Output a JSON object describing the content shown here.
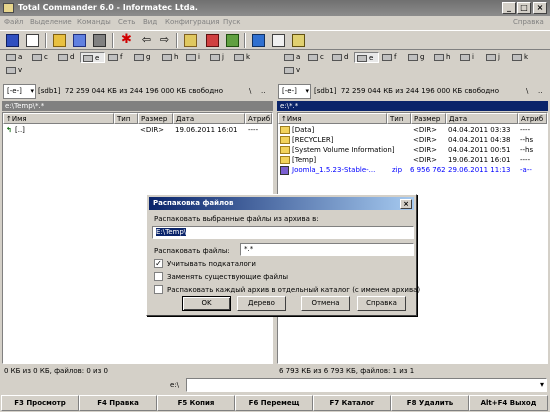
{
  "window": {
    "title": "Total Commander 6.0 - Informatec Ltda."
  },
  "menu": {
    "items": [
      "Файл",
      "Выделение",
      "Команды",
      "Сеть",
      "Вид",
      "Конфигурация",
      "Пуск"
    ],
    "help": "Справка"
  },
  "drives": [
    "a",
    "c",
    "d",
    "e",
    "f",
    "g",
    "h",
    "i",
    "j",
    "k",
    "v"
  ],
  "left": {
    "drive_select": "[-e-]",
    "volume": "[sdb1]",
    "free_info": "72 259 044 КБ из 244 196 000 КБ свободно",
    "root_btn": "\\",
    "up_btn": "..",
    "path": "e:\\Temp\\*.*",
    "active_drive": "e"
  },
  "right": {
    "drive_select": "[-e-]",
    "volume": "[sdb1]",
    "free_info": "72 259 044 КБ из 244 196 000 КБ свободно",
    "root_btn": "\\",
    "up_btn": "..",
    "path": "e:\\*.*",
    "active_drive": "e"
  },
  "columns": {
    "name": "↑Имя",
    "type": "Тип",
    "size": "Размер",
    "date": "Дата",
    "attr": "Атриб"
  },
  "left_files": [
    {
      "name": "[..]",
      "size": "<DIR>",
      "date": "19.06.2011 16:01",
      "attr": "----"
    }
  ],
  "right_files": [
    {
      "name": "[Data]",
      "size": "<DIR>",
      "date": "04.04.2011 03:33",
      "attr": "----"
    },
    {
      "name": "[RECYCLER]",
      "size": "<DIR>",
      "date": "04.04.2011 04:38",
      "attr": "--hs"
    },
    {
      "name": "[System Volume Information]",
      "size": "<DIR>",
      "date": "04.04.2011 00:51",
      "attr": "--hs"
    },
    {
      "name": "[Temp]",
      "size": "<DIR>",
      "date": "19.06.2011 16:01",
      "attr": "----"
    },
    {
      "name": "Joomla_1.5.23-Stable-...",
      "type": "zip",
      "size": "6 956 762",
      "date": "29.06.2011 11:13",
      "attr": "-a--"
    }
  ],
  "status": {
    "left": "0 КБ из 0 КБ, файлов: 0 из 0",
    "right": "6 793 КБ из 6 793 КБ, файлов: 1 из 1"
  },
  "cmdline": {
    "prompt": "e:\\"
  },
  "fkeys": [
    "F3 Просмотр",
    "F4 Правка",
    "F5 Копия",
    "F6 Перемещ",
    "F7 Каталог",
    "F8 Удалить",
    "Alt+F4 Выход"
  ],
  "dialog": {
    "title": "Распаковка файлов",
    "extract_label": "Распаковать выбранные файлы из архива в:",
    "dest_value": "E:\\Temp\\",
    "files_label": "Распаковать файлы:",
    "files_value": "*.*",
    "opt_subdirs": "Учитывать подкаталоги",
    "opt_subdirs_checked": "✓",
    "opt_overwrite": "Заменять существующие файлы",
    "opt_separate": "Распаковать каждый архив в отдельный каталог (с именем архива)",
    "ok": "OK",
    "tree": "Дерево",
    "cancel": "Отмена",
    "help": "Справка"
  },
  "colors": {
    "title_inactive": "#808080",
    "dialog_title": "#0a246a",
    "path_active": "#0a246a",
    "zip_file": "#0000ff"
  }
}
